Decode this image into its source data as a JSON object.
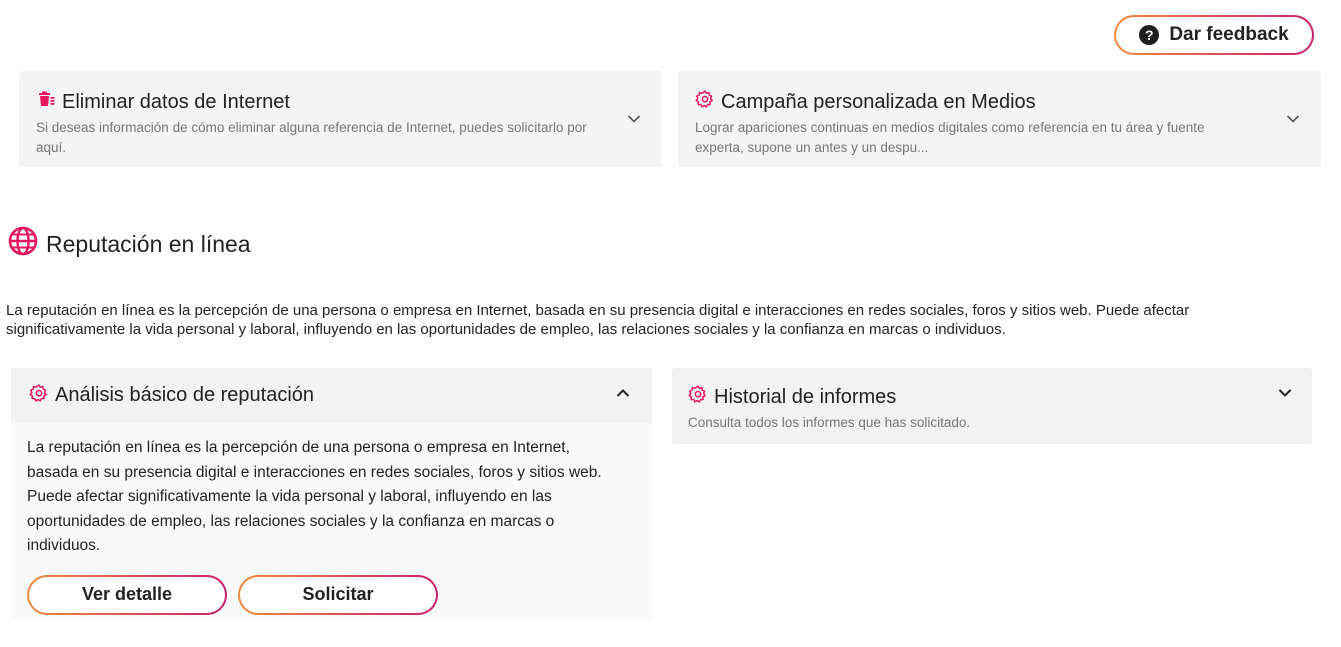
{
  "feedback": {
    "label": "Dar feedback",
    "icon": "question-circle-icon"
  },
  "top_cards": [
    {
      "title": "Eliminar datos de Internet",
      "description": "Si deseas información de cómo eliminar alguna referencia de Internet, puedes solicitarlo por aquí.",
      "icon": "trash-icon"
    },
    {
      "title": "Campaña personalizada en Medios",
      "description": "Lograr apariciones continuas en medios digitales como referencia en tu área y fuente experta, supone un antes y un despu...",
      "icon": "gear-icon"
    }
  ],
  "section": {
    "title": "Reputación en línea",
    "icon": "globe-icon",
    "description": "La reputación en línea es la percepción de una persona o empresa en Internet, basada en su presencia digital e interacciones en redes sociales, foros y sitios web. Puede afectar significativamente la vida personal y laboral, influyendo en las oportunidades de empleo, las relaciones sociales y la confianza en marcas o individuos."
  },
  "analysis_panel": {
    "title": "Análisis básico de reputación",
    "body": "La reputación en línea es la percepción de una persona o empresa en Internet, basada en su presencia digital e interacciones en redes sociales, foros y sitios web. Puede afectar significativamente la vida personal y laboral, influyendo en las oportunidades de empleo, las relaciones sociales y la confianza en marcas o individuos.",
    "detail_label": "Ver detalle",
    "request_label": "Solicitar"
  },
  "history_card": {
    "title": "Historial de informes",
    "description": "Consulta todos los informes que has solicitado."
  },
  "colors": {
    "accent": "#e8175d",
    "gradient_start": "#f08a3c",
    "gradient_end": "#c81e6e",
    "card_bg": "#f4f4f4"
  }
}
